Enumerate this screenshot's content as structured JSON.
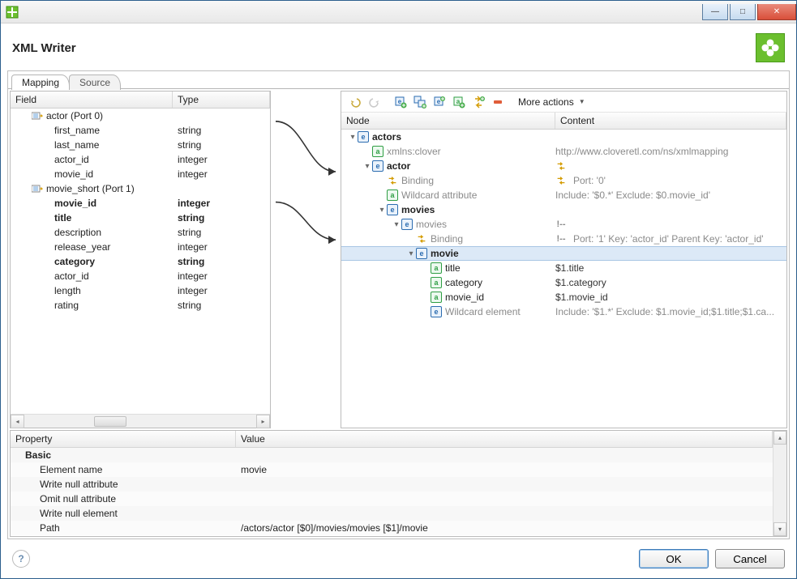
{
  "window": {
    "title": "XML Writer"
  },
  "tabs": {
    "mapping": "Mapping",
    "source": "Source"
  },
  "fields_table": {
    "headers": {
      "field": "Field",
      "type": "Type"
    },
    "ports": [
      {
        "label": "actor (Port 0)",
        "fields": [
          {
            "name": "first_name",
            "type": "string",
            "bold": false
          },
          {
            "name": "last_name",
            "type": "string",
            "bold": false
          },
          {
            "name": "actor_id",
            "type": "integer",
            "bold": false
          },
          {
            "name": "movie_id",
            "type": "integer",
            "bold": false
          }
        ]
      },
      {
        "label": "movie_short (Port 1)",
        "fields": [
          {
            "name": "movie_id",
            "type": "integer",
            "bold": true
          },
          {
            "name": "title",
            "type": "string",
            "bold": true
          },
          {
            "name": "description",
            "type": "string",
            "bold": false
          },
          {
            "name": "release_year",
            "type": "integer",
            "bold": false
          },
          {
            "name": "category",
            "type": "string",
            "bold": true
          },
          {
            "name": "actor_id",
            "type": "integer",
            "bold": false
          },
          {
            "name": "length",
            "type": "integer",
            "bold": false
          },
          {
            "name": "rating",
            "type": "string",
            "bold": false
          }
        ]
      }
    ]
  },
  "toolbar": {
    "undo": "undo-icon",
    "redo": "redo-icon",
    "add_elem": "add-element-icon",
    "add_child": "add-child-element-icon",
    "add_attr": "add-attribute-icon",
    "add_text": "add-text-icon",
    "add_binding": "add-binding-icon",
    "remove": "remove-icon",
    "more_label": "More actions"
  },
  "nodes": {
    "headers": {
      "node": "Node",
      "content": "Content"
    },
    "rows": [
      {
        "depth": 0,
        "tw": "▾",
        "icon": "e",
        "label": "actors",
        "content": "",
        "muted": false,
        "sel": false
      },
      {
        "depth": 1,
        "tw": "",
        "icon": "a",
        "label": "xmlns:clover",
        "content": "http://www.cloveretl.com/ns/xmlmapping",
        "muted": true,
        "sel": false
      },
      {
        "depth": 1,
        "tw": "▾",
        "icon": "e",
        "label": "actor",
        "content": "",
        "muted": false,
        "cicon": "bind",
        "sel": false
      },
      {
        "depth": 2,
        "tw": "",
        "icon": "bind",
        "label": "Binding",
        "content": "Port: '0'",
        "muted": true,
        "cicon": "bind",
        "sel": false
      },
      {
        "depth": 2,
        "tw": "",
        "icon": "a",
        "label": "Wildcard attribute",
        "content": "Include: '$0.*' Exclude: $0.movie_id'",
        "muted": true,
        "sel": false
      },
      {
        "depth": 2,
        "tw": "▾",
        "icon": "e",
        "label": "movies",
        "content": "",
        "muted": false,
        "sel": false
      },
      {
        "depth": 3,
        "tw": "▾",
        "icon": "e",
        "label": "movies",
        "content": "",
        "muted": true,
        "cicon": "cm",
        "sel": false
      },
      {
        "depth": 4,
        "tw": "",
        "icon": "bind",
        "label": "Binding",
        "content": "Port: '1' Key: 'actor_id' Parent Key: 'actor_id'",
        "muted": true,
        "cicon": "cm",
        "sel": false
      },
      {
        "depth": 4,
        "tw": "▾",
        "icon": "e",
        "label": "movie",
        "content": "",
        "muted": false,
        "sel": true
      },
      {
        "depth": 5,
        "tw": "",
        "icon": "a",
        "label": "title",
        "content": "$1.title",
        "muted": false,
        "sel": false
      },
      {
        "depth": 5,
        "tw": "",
        "icon": "a",
        "label": "category",
        "content": "$1.category",
        "muted": false,
        "sel": false
      },
      {
        "depth": 5,
        "tw": "",
        "icon": "a",
        "label": "movie_id",
        "content": "$1.movie_id",
        "muted": false,
        "sel": false
      },
      {
        "depth": 5,
        "tw": "",
        "icon": "e",
        "label": "Wildcard element",
        "content": "Include: '$1.*' Exclude: $1.movie_id;$1.title;$1.ca...",
        "muted": true,
        "sel": false
      }
    ]
  },
  "properties": {
    "headers": {
      "prop": "Property",
      "val": "Value"
    },
    "group": "Basic",
    "rows": [
      {
        "p": "Element name",
        "v": "movie"
      },
      {
        "p": "Write null attribute",
        "v": ""
      },
      {
        "p": "Omit null attribute",
        "v": ""
      },
      {
        "p": "Write null element",
        "v": ""
      },
      {
        "p": "Path",
        "v": "/actors/actor [$0]/movies/movies [$1]/movie"
      }
    ]
  },
  "footer": {
    "ok": "OK",
    "cancel": "Cancel"
  }
}
